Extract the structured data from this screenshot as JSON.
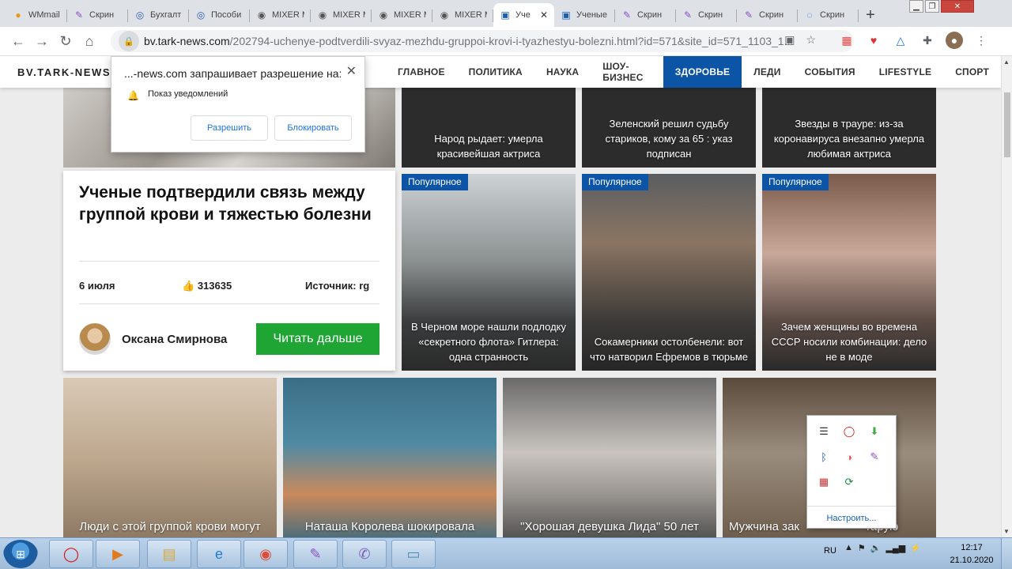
{
  "tabs": [
    {
      "label": "WMmail",
      "icon": "wmmail-icon"
    },
    {
      "label": "Скрин",
      "icon": "feather-icon"
    },
    {
      "label": "Бухгалт",
      "icon": "globe-icon"
    },
    {
      "label": "Пособи",
      "icon": "globe-icon"
    },
    {
      "label": "MIXER M",
      "icon": "mixer-icon"
    },
    {
      "label": "MIXER M",
      "icon": "mixer-icon"
    },
    {
      "label": "MIXER M",
      "icon": "mixer-icon"
    },
    {
      "label": "MIXER M",
      "icon": "mixer-icon"
    },
    {
      "label": "Уче",
      "icon": "page-icon",
      "active": true
    },
    {
      "label": "Ученые",
      "icon": "page-icon"
    },
    {
      "label": "Скрин",
      "icon": "feather-icon"
    },
    {
      "label": "Скрин",
      "icon": "feather-icon"
    },
    {
      "label": "Скрин",
      "icon": "feather-icon"
    },
    {
      "label": "Скрин",
      "icon": "loading-icon"
    }
  ],
  "address": {
    "host": "bv.tark-news.com",
    "path": "/202794-uchenye-podtverdili-svyaz-mezhdu-gruppoi-krovi-i-tyazhestyu-bolezni.html?id=571&site_id=571_1103_1..."
  },
  "site": {
    "logo": "BV.TARK-NEWS",
    "menu": [
      "ГЛАВНОЕ",
      "ПОЛИТИКА",
      "НАУКА",
      "ШОУ-БИЗНЕС",
      "ЗДОРОВЬЕ",
      "ЛЕДИ",
      "СОБЫТИЯ",
      "LIFESTYLE",
      "СПОРТ"
    ],
    "active_menu": "ЗДОРОВЬЕ"
  },
  "permission": {
    "title": "...-news.com запрашивает разрешение на:",
    "desc": "Показ уведомлений",
    "allow": "Разрешить",
    "block": "Блокировать"
  },
  "article": {
    "title": "Ученые подтвердили связь между группой крови и тяжестью болезни",
    "date": "6 июля",
    "likes": "313635",
    "source": "Источник: rg",
    "author": "Оксана Смирнова",
    "read_more": "Читать дальше"
  },
  "top_cards": [
    {
      "caption": "Народ рыдает: умерла красивейшая актриса"
    },
    {
      "caption": "Зеленский решил судьбу стариков, кому за 65 : указ подписан"
    },
    {
      "caption": "Звезды в трауре: из-за коронавируса внезапно умерла любимая актриса"
    }
  ],
  "popular_cards": [
    {
      "badge": "Популярное",
      "caption": "В Черном море нашли подлодку «секретного флота» Гитлера: одна странность"
    },
    {
      "badge": "Популярное",
      "caption": "Сокамерники остолбенели: вот что натворил Ефремов в тюрьме"
    },
    {
      "badge": "Популярное",
      "caption": "Зачем женщины во времена СССР носили комбинации: дело не в моде"
    }
  ],
  "bottom_cards": [
    {
      "caption": "Люди с этой группой крови могут"
    },
    {
      "caption": "Наташа Королева шокировала"
    },
    {
      "caption": "\"Хорошая девушка Лида\" 50 лет"
    },
    {
      "caption": "Мужчина зак                    тарую"
    }
  ],
  "tray_popup": {
    "customize": "Настроить..."
  },
  "taskbar": {
    "lang": "RU",
    "time": "12:17",
    "date": "21.10.2020"
  },
  "colors": {
    "accent": "#0c55a6",
    "button_green": "#1ea534"
  }
}
